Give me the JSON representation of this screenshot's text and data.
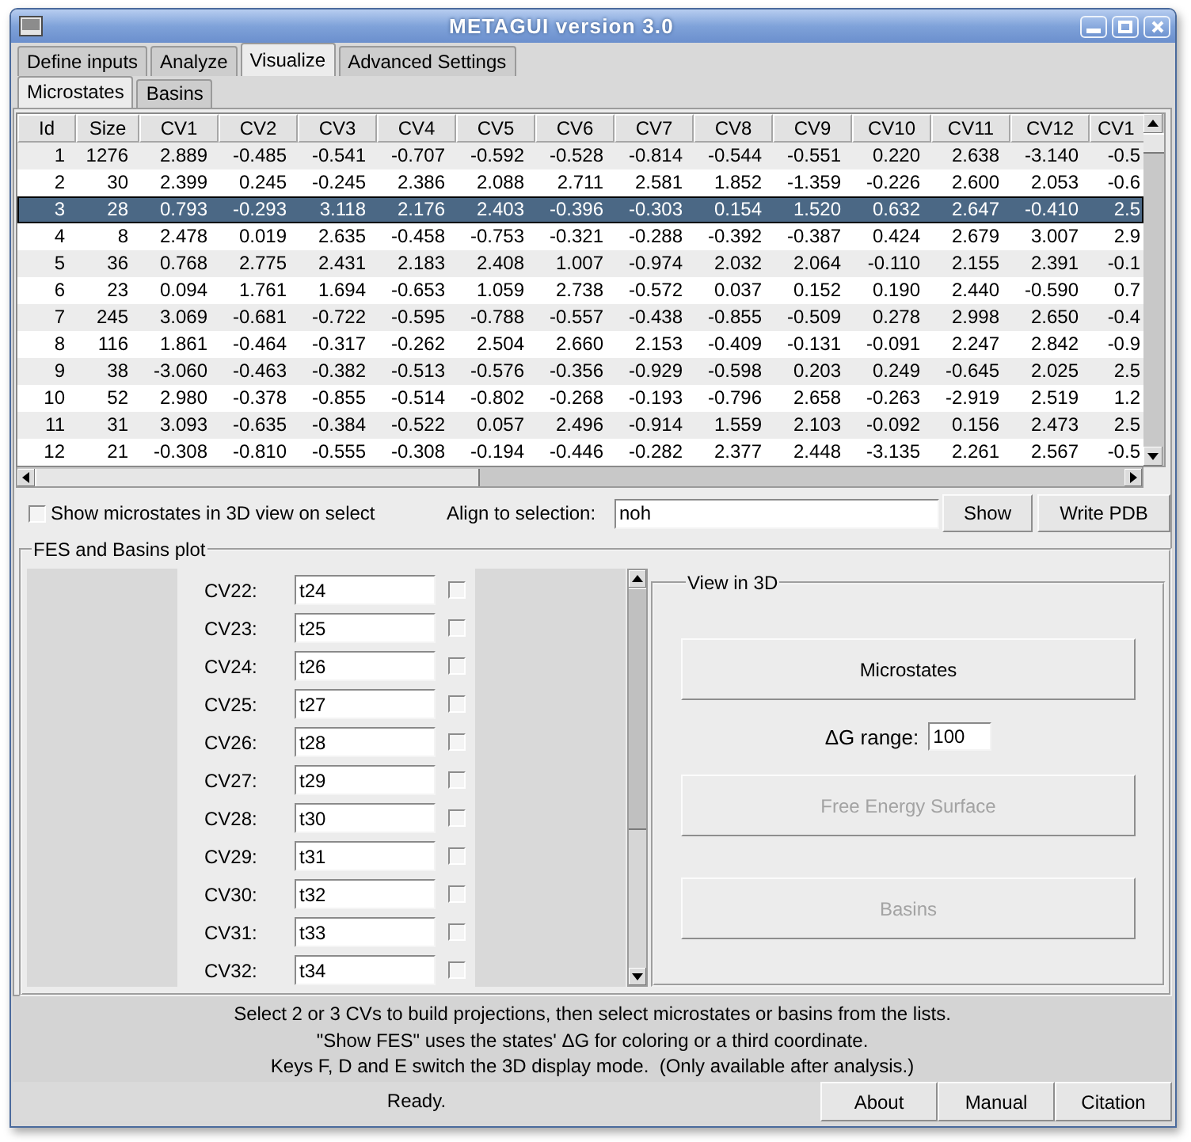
{
  "window": {
    "title": "METAGUI version 3.0"
  },
  "tabs": [
    {
      "label": "Define inputs",
      "selected": false
    },
    {
      "label": "Analyze",
      "selected": false
    },
    {
      "label": "Visualize",
      "selected": true
    },
    {
      "label": "Advanced Settings",
      "selected": false
    }
  ],
  "subtabs": [
    {
      "label": "Microstates",
      "selected": true
    },
    {
      "label": "Basins",
      "selected": false
    }
  ],
  "table": {
    "columns": [
      "Id",
      "Size",
      "CV1",
      "CV2",
      "CV3",
      "CV4",
      "CV5",
      "CV6",
      "CV7",
      "CV8",
      "CV9",
      "CV10",
      "CV11",
      "CV12",
      "CV1"
    ],
    "rows": [
      {
        "selected": false,
        "cells": [
          "1",
          "1276",
          "2.889",
          "-0.485",
          "-0.541",
          "-0.707",
          "-0.592",
          "-0.528",
          "-0.814",
          "-0.544",
          "-0.551",
          "0.220",
          "2.638",
          "-3.140",
          "-0.5"
        ]
      },
      {
        "selected": false,
        "cells": [
          "2",
          "30",
          "2.399",
          "0.245",
          "-0.245",
          "2.386",
          "2.088",
          "2.711",
          "2.581",
          "1.852",
          "-1.359",
          "-0.226",
          "2.600",
          "2.053",
          "-0.6"
        ]
      },
      {
        "selected": true,
        "cells": [
          "3",
          "28",
          "0.793",
          "-0.293",
          "3.118",
          "2.176",
          "2.403",
          "-0.396",
          "-0.303",
          "0.154",
          "1.520",
          "0.632",
          "2.647",
          "-0.410",
          "2.5"
        ]
      },
      {
        "selected": false,
        "cells": [
          "4",
          "8",
          "2.478",
          "0.019",
          "2.635",
          "-0.458",
          "-0.753",
          "-0.321",
          "-0.288",
          "-0.392",
          "-0.387",
          "0.424",
          "2.679",
          "3.007",
          "2.9"
        ]
      },
      {
        "selected": false,
        "cells": [
          "5",
          "36",
          "0.768",
          "2.775",
          "2.431",
          "2.183",
          "2.408",
          "1.007",
          "-0.974",
          "2.032",
          "2.064",
          "-0.110",
          "2.155",
          "2.391",
          "-0.1"
        ]
      },
      {
        "selected": false,
        "cells": [
          "6",
          "23",
          "0.094",
          "1.761",
          "1.694",
          "-0.653",
          "1.059",
          "2.738",
          "-0.572",
          "0.037",
          "0.152",
          "0.190",
          "2.440",
          "-0.590",
          "0.7"
        ]
      },
      {
        "selected": false,
        "cells": [
          "7",
          "245",
          "3.069",
          "-0.681",
          "-0.722",
          "-0.595",
          "-0.788",
          "-0.557",
          "-0.438",
          "-0.855",
          "-0.509",
          "0.278",
          "2.998",
          "2.650",
          "-0.4"
        ]
      },
      {
        "selected": false,
        "cells": [
          "8",
          "116",
          "1.861",
          "-0.464",
          "-0.317",
          "-0.262",
          "2.504",
          "2.660",
          "2.153",
          "-0.409",
          "-0.131",
          "-0.091",
          "2.247",
          "2.842",
          "-0.9"
        ]
      },
      {
        "selected": false,
        "cells": [
          "9",
          "38",
          "-3.060",
          "-0.463",
          "-0.382",
          "-0.513",
          "-0.576",
          "-0.356",
          "-0.929",
          "-0.598",
          "0.203",
          "0.249",
          "-0.645",
          "2.025",
          "2.5"
        ]
      },
      {
        "selected": false,
        "cells": [
          "10",
          "52",
          "2.980",
          "-0.378",
          "-0.855",
          "-0.514",
          "-0.802",
          "-0.268",
          "-0.193",
          "-0.796",
          "2.658",
          "-0.263",
          "-2.919",
          "2.519",
          "1.2"
        ]
      },
      {
        "selected": false,
        "cells": [
          "11",
          "31",
          "3.093",
          "-0.635",
          "-0.384",
          "-0.522",
          "0.057",
          "2.496",
          "-0.914",
          "1.559",
          "2.103",
          "-0.092",
          "0.156",
          "2.473",
          "2.5"
        ]
      },
      {
        "selected": false,
        "cells": [
          "12",
          "21",
          "-0.308",
          "-0.810",
          "-0.555",
          "-0.308",
          "-0.194",
          "-0.446",
          "-0.282",
          "2.377",
          "2.448",
          "-3.135",
          "2.261",
          "2.567",
          "-0.5"
        ]
      }
    ]
  },
  "show_in_3d": {
    "label": "Show microstates in 3D view on select",
    "checked": false
  },
  "align": {
    "label": "Align to selection:",
    "value": "noh"
  },
  "actions": [
    "Show",
    "Write PDB"
  ],
  "fes_panel": {
    "title": "FES and Basins plot",
    "cv_rows": [
      {
        "label": "CV22:",
        "value": "t24",
        "checked": false
      },
      {
        "label": "CV23:",
        "value": "t25",
        "checked": false
      },
      {
        "label": "CV24:",
        "value": "t26",
        "checked": false
      },
      {
        "label": "CV25:",
        "value": "t27",
        "checked": false
      },
      {
        "label": "CV26:",
        "value": "t28",
        "checked": false
      },
      {
        "label": "CV27:",
        "value": "t29",
        "checked": false
      },
      {
        "label": "CV28:",
        "value": "t30",
        "checked": false
      },
      {
        "label": "CV29:",
        "value": "t31",
        "checked": false
      },
      {
        "label": "CV30:",
        "value": "t32",
        "checked": false
      },
      {
        "label": "CV31:",
        "value": "t33",
        "checked": false
      },
      {
        "label": "CV32:",
        "value": "t34",
        "checked": false
      }
    ],
    "view3d": {
      "title": "View in 3D",
      "items": [
        {
          "kind": "button",
          "label": "Microstates",
          "disabled": false
        },
        {
          "kind": "field",
          "label": "ΔG range:",
          "value": "100"
        },
        {
          "kind": "button",
          "label": "Free Energy Surface",
          "disabled": true
        },
        {
          "kind": "button",
          "label": "Basins",
          "disabled": true
        }
      ]
    }
  },
  "help": [
    "Select 2 or 3 CVs to build projections, then select microstates or basins from the lists.",
    "\"Show FES\" uses the states' ΔG for coloring or a third coordinate.",
    "Keys F, D and E switch the 3D display mode.  (Only available after analysis.)"
  ],
  "status_bar": {
    "text": "Ready.",
    "buttons": [
      "About",
      "Manual",
      "Citation"
    ]
  }
}
